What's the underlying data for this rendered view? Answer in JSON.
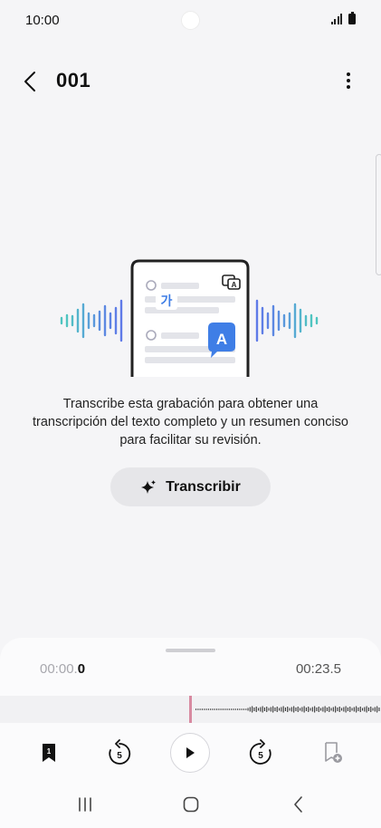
{
  "status_bar": {
    "time": "10:00"
  },
  "header": {
    "title": "001"
  },
  "empty_state": {
    "description": "Transcribe esta grabación para obtener una transcripción del texto completo y un resumen conciso para facilitar su revisión.",
    "button_label": "Transcribir",
    "illustration_glyph_ko": "가",
    "illustration_glyph_a": "A"
  },
  "player": {
    "current_time_prefix": "00:00.",
    "current_time_suffix": "0",
    "total_time": "00:23.5",
    "progress": 0.0
  },
  "icons": {
    "back": "chevron-left-icon",
    "more": "more-vertical-icon",
    "transcribe": "sparkle-icon",
    "bookmark": "bookmark-icon",
    "rewind": "rewind-5-icon",
    "play": "play-icon",
    "forward": "forward-5-icon",
    "add_bookmark": "add-bookmark-icon"
  },
  "colors": {
    "accent_blue": "#3f7ee6",
    "wave_teal": "#4fc4c0",
    "playhead": "#d88aa1"
  },
  "controls": {
    "skip_seconds": "5",
    "bookmark_number": "1"
  }
}
